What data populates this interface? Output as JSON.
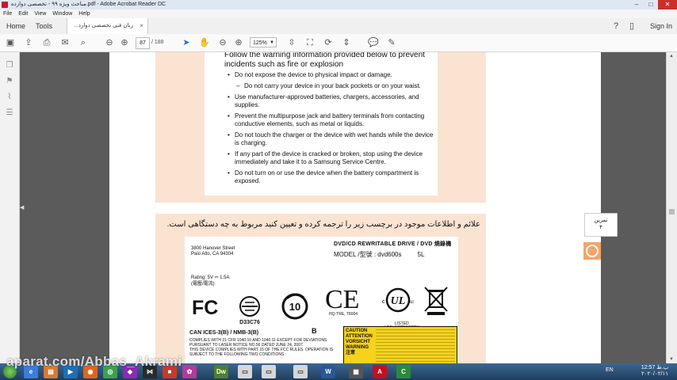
{
  "window": {
    "title": "مباحث ویژه ۹۹ - تخصصی دوازده.pdf - Adobe Acrobat Reader DC",
    "buttons": {
      "minimize": "–",
      "maximize": "□",
      "close": "✕"
    }
  },
  "menu": [
    "File",
    "Edit",
    "View",
    "Window",
    "Help"
  ],
  "tabs": {
    "home": "Home",
    "tools": "Tools",
    "document": "...زبان فنی تخصصی دوازد",
    "close": "×",
    "sign_in": "Sign In"
  },
  "toolbar": {
    "page_current": "87",
    "page_count": "/ 188",
    "zoom": "125%"
  },
  "warning": {
    "heading": "Follow the warning information provided below to prevent incidents such as fire or explosion",
    "items": [
      {
        "text": "Do not expose the device to physical impact or damage.",
        "sub": false
      },
      {
        "text": "Do not carry your device in your back pockets or on your waist.",
        "sub": true
      },
      {
        "text": "Use manufacturer-approved batteries, chargers, accessories, and supplies.",
        "sub": false
      },
      {
        "text": "Prevent the multipurpose jack and battery terminals from contacting conductive elements, such as metal or liquids.",
        "sub": false
      },
      {
        "text": "Do not touch the charger or the device with wet hands while the device is charging.",
        "sub": false
      },
      {
        "text": "If any part of the device is cracked or broken, stop using the device immediately and take it to a Samsung Service Centre.",
        "sub": false
      },
      {
        "text": "Do not turn on or use the device when the battery compartment is exposed.",
        "sub": false
      }
    ]
  },
  "exercise": {
    "question": "علائم و اطلاعات موجود در برچسب زیر را ترجمه کرده و تعیین کنید مربوط به چه دستگاهی است.",
    "card_line1": "تمرین",
    "card_line2": "۴"
  },
  "label": {
    "address": "3800 Hanover Street\nPalo Alto, CA 94304",
    "title": "DVD/CD REWRITABLE DRIVE / DVD 燒錄機",
    "model": "MODEL /型號 : dvd600s",
    "model_suffix": "5L",
    "rating": "Rating: 5V ⎓ 1.5A\n(電壓/電流)",
    "fc": "FC",
    "d33": "D33C76",
    "ten": "10",
    "ce": "CE",
    "hq": "HQ-TRE, T8004",
    "ul": "UL",
    "ul_text": "LISTED\nI.T.E. ACCESSORY\nE209619",
    "ices": "CAN ICES-3(B) / NMB-3(B)",
    "b": "B",
    "fcc": "COMPLIES WITH 21 CFR 1040.10 AND 1040.11 EXCEPT FOR DEVIATIONS PURSUANT TO LASER NOTICE NO.56 DATED JUNE 24, 2007.\nTHIS DEVICE COMPLIES WITH PART 15 OF THE FCC RULES. OPERATION IS SUBJECT TO THE FOLLOWING TWO CONDITIONS :",
    "caution_words": "CAUTION\nATTENTION\nVORSICHT\nWARNING\n注意"
  },
  "taskbar": {
    "watermark": "aparat.com/Abbas_Akrami",
    "lang": "EN",
    "time": "12:57 ب.ظ",
    "date": "۲۰۲۰/۰۲/۱۱"
  },
  "colors": {
    "peach": "#fbe3d2",
    "caution_yellow": "#f5d21d",
    "accent_blue": "#2470c8"
  }
}
